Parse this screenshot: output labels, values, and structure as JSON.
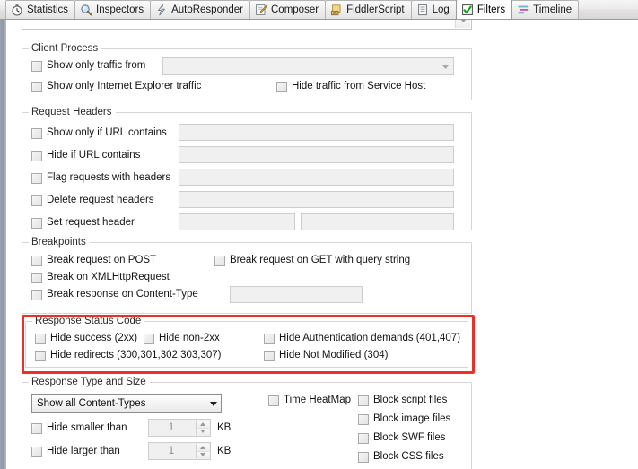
{
  "window": {
    "accent_red": "#e8312a",
    "panel_bg": "#ffffff"
  },
  "tabs": [
    {
      "label": "Statistics",
      "icon": "stopwatch-icon",
      "active": false
    },
    {
      "label": "Inspectors",
      "icon": "magnifier-icon",
      "active": false
    },
    {
      "label": "AutoResponder",
      "icon": "lightning-bolt-icon",
      "active": false
    },
    {
      "label": "Composer",
      "icon": "pencil-note-icon",
      "active": false
    },
    {
      "label": "FiddlerScript",
      "icon": "js-scroll-icon",
      "active": false
    },
    {
      "label": "Log",
      "icon": "document-lines-icon",
      "active": false
    },
    {
      "label": "Filters",
      "icon": "green-check-icon",
      "active": true
    },
    {
      "label": "Timeline",
      "icon": "timeline-bars-icon",
      "active": false
    }
  ],
  "top_combo": {
    "value": "",
    "placeholder": "",
    "arrow_icon": "chevron-down-icon"
  },
  "client_process": {
    "legend": "Client Process",
    "show_only_traffic_from": {
      "label": "Show only traffic from",
      "checked": false,
      "combo_value": "",
      "combo_arrow_icon": "chevron-down-icon"
    },
    "show_only_ie_traffic": {
      "label": "Show only Internet Explorer traffic",
      "checked": false
    },
    "hide_traffic_service_host": {
      "label": "Hide traffic from Service Host",
      "checked": false
    }
  },
  "request_headers": {
    "legend": "Request Headers",
    "rows": [
      {
        "label": "Show only if URL contains",
        "checked": false,
        "value": ""
      },
      {
        "label": "Hide if URL contains",
        "checked": false,
        "value": ""
      },
      {
        "label": "Flag requests with headers",
        "checked": false,
        "value": ""
      },
      {
        "label": "Delete request headers",
        "checked": false,
        "value": ""
      },
      {
        "label": "Set request header",
        "checked": false,
        "value": "",
        "value2": ""
      }
    ]
  },
  "breakpoints": {
    "legend": "Breakpoints",
    "break_request_post": {
      "label": "Break request on POST",
      "checked": false
    },
    "break_request_get_query": {
      "label": "Break request on GET with query string",
      "checked": false
    },
    "break_xhr": {
      "label": "Break on XMLHttpRequest",
      "checked": false
    },
    "break_response_ct": {
      "label": "Break response on Content-Type",
      "checked": false,
      "value": ""
    }
  },
  "response_status_code": {
    "legend": "Response Status Code",
    "highlighted": true,
    "hide_success": {
      "label": "Hide success (2xx)",
      "checked": false
    },
    "hide_non_2xx": {
      "label": "Hide non-2xx",
      "checked": false
    },
    "hide_auth_demands": {
      "label": "Hide Authentication demands (401,407)",
      "checked": false
    },
    "hide_redirects": {
      "label": "Hide redirects (300,301,302,303,307)",
      "checked": false
    },
    "hide_not_modified": {
      "label": "Hide Not Modified (304)",
      "checked": false
    }
  },
  "response_type_size": {
    "legend": "Response Type and Size",
    "content_types": {
      "selected": "Show all Content-Types",
      "arrow_icon": "chevron-down-icon"
    },
    "hide_smaller_than": {
      "label": "Hide smaller than",
      "checked": false,
      "value": "1",
      "unit": "KB"
    },
    "hide_larger_than": {
      "label": "Hide larger than",
      "checked": false,
      "value": "1",
      "unit": "KB"
    },
    "time_heatmap": {
      "label": "Time HeatMap",
      "checked": false
    },
    "block_script_files": {
      "label": "Block script files",
      "checked": false
    },
    "block_image_files": {
      "label": "Block image files",
      "checked": false
    },
    "block_swf_files": {
      "label": "Block SWF files",
      "checked": false
    },
    "block_css_files": {
      "label": "Block CSS files",
      "checked": false
    }
  }
}
